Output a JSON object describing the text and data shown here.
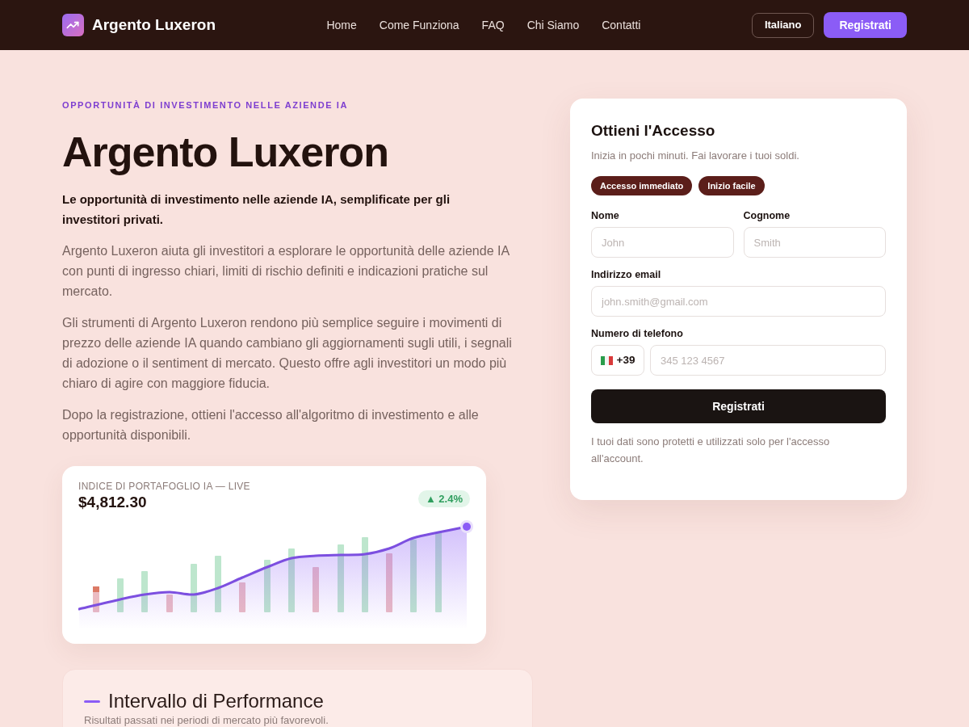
{
  "header": {
    "brand": "Argento Luxeron",
    "nav": [
      "Home",
      "Come Funziona",
      "FAQ",
      "Chi Siamo",
      "Contatti"
    ],
    "language_button": "Italiano",
    "register_button": "Registrati"
  },
  "hero": {
    "eyebrow": "OPPORTUNITÀ DI INVESTIMENTO NELLE AZIENDE IA",
    "title": "Argento Luxeron",
    "lead": "Le opportunità di investimento nelle aziende IA, semplificate per gli investitori privati.",
    "paragraphs": [
      "Argento Luxeron aiuta gli investitori a esplorare le opportunità delle aziende IA con punti di ingresso chiari, limiti di rischio definiti e indicazioni pratiche sul mercato.",
      "Gli strumenti di Argento Luxeron rendono più semplice seguire i movimenti di prezzo delle aziende IA quando cambiano gli aggiornamenti sugli utili, i segnali di adozione o il sentiment di mercato. Questo offre agli investitori un modo più chiaro di agire con maggiore fiducia.",
      "Dopo la registrazione, ottieni l'accesso all'algoritmo di investimento e alle opportunità disponibili."
    ]
  },
  "signup_form": {
    "title": "Ottieni l'Accesso",
    "subtitle": "Inizia in pochi minuti. Fai lavorare i tuoi soldi.",
    "badges": [
      "Accesso immediato",
      "Inizio facile"
    ],
    "rows": [
      [
        {
          "kind": "text",
          "label": "Nome",
          "placeholder": "John"
        },
        {
          "kind": "text",
          "label": "Cognome",
          "placeholder": "Smith"
        }
      ],
      [
        {
          "kind": "text",
          "label": "Indirizzo email",
          "placeholder": "john.smith@gmail.com"
        }
      ],
      [
        {
          "kind": "phone",
          "label": "Numero di telefono",
          "country_code": "+39",
          "placeholder": "345 123 4567"
        }
      ]
    ],
    "submit": "Registrati",
    "note": "I tuoi dati sono protetti e utilizzati solo per l'accesso all'account."
  },
  "index_card": {
    "label": "INDICE DI PORTAFOGLIO IA — LIVE",
    "value": "$4,812.30",
    "change": "▲ 2.4%"
  },
  "performance": {
    "title": "Intervallo di Performance",
    "subtitle": "Risultati passati nei periodi di mercato più favorevoli."
  }
}
